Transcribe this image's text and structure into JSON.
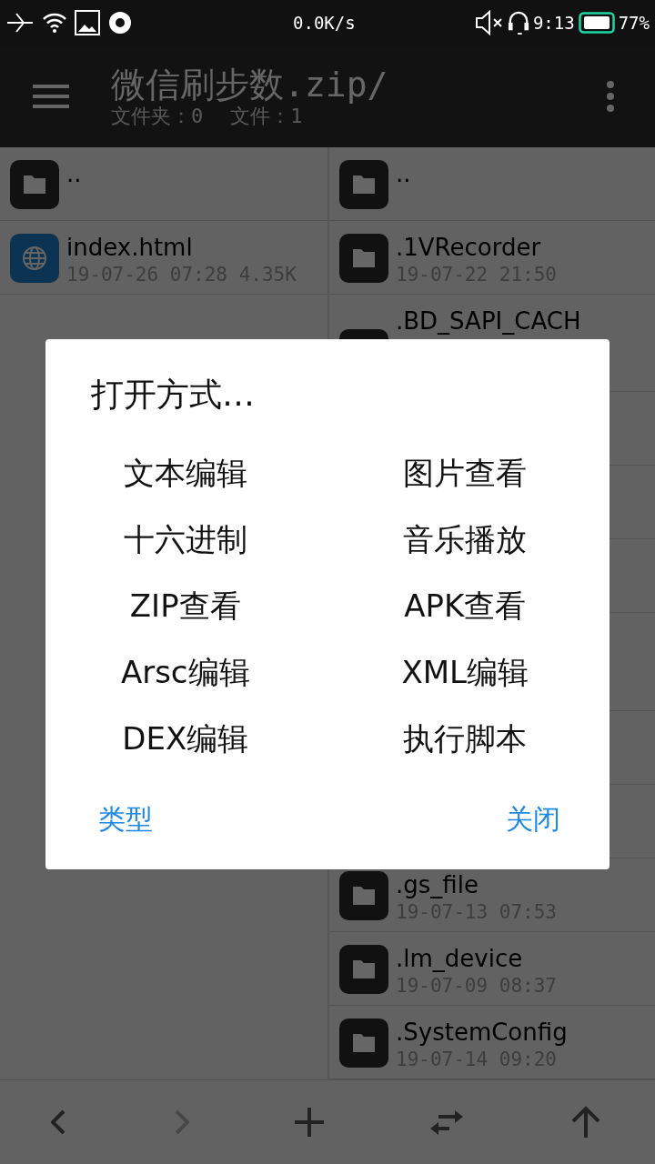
{
  "status_bar": {
    "net_speed": "0.0K/s",
    "time": "9:13",
    "battery": "77%"
  },
  "header": {
    "title": "微信刷步数.zip/",
    "counts": [
      "文件夹：0",
      "文件：1"
    ]
  },
  "left_pane": {
    "items": [
      {
        "kind": "folder",
        "name": ".."
      },
      {
        "kind": "web",
        "name": "index.html",
        "meta": "19-07-26 07:28 4.35K"
      }
    ]
  },
  "right_pane": {
    "top_items": [
      {
        "kind": "folder",
        "name": ".."
      },
      {
        "kind": "folder",
        "name": ".1VRecorder",
        "meta": "19-07-22 21:50"
      },
      {
        "kind": "folder",
        "name": ".BD_SAPI_CACH"
      }
    ],
    "bottom_items": [
      {
        "kind": "folder",
        "name": ".gs_file",
        "meta": "19-07-13 07:53"
      },
      {
        "kind": "folder",
        "name": ".lm_device",
        "meta": "19-07-09 08:37"
      },
      {
        "kind": "folder",
        "name": ".SystemConfig",
        "meta": "19-07-14 09:20"
      }
    ]
  },
  "dialog": {
    "title": "打开方式…",
    "options": [
      "文本编辑",
      "图片查看",
      "十六进制",
      "音乐播放",
      "ZIP查看",
      "APK查看",
      "Arsc编辑",
      "XML编辑",
      "DEX编辑",
      "执行脚本"
    ],
    "buttons": [
      "类型",
      "关闭"
    ]
  },
  "toolbar": [
    {
      "kind": "back",
      "disabled": false
    },
    {
      "kind": "forward",
      "disabled": true
    },
    {
      "kind": "add",
      "disabled": false
    },
    {
      "kind": "swap",
      "disabled": false
    },
    {
      "kind": "up",
      "disabled": false
    }
  ]
}
